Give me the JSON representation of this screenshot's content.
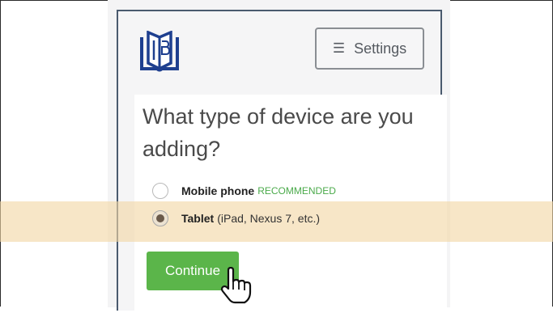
{
  "header": {
    "logo_icon": "book-logo-icon",
    "settings_label": "Settings",
    "settings_icon": "hamburger-menu-icon"
  },
  "question": "What type of device are you adding?",
  "options": [
    {
      "title": "Mobile phone",
      "tag": "RECOMMENDED",
      "note": "",
      "selected": false
    },
    {
      "title": "Tablet",
      "tag": "",
      "note": "(iPad, Nexus 7, etc.)",
      "selected": true
    }
  ],
  "continue_label": "Continue",
  "colors": {
    "brand": "#1e3f8f",
    "primary_button": "#5bb54a",
    "recommended": "#4aaa4a",
    "highlight": "#f2d6a5"
  },
  "cursor_icon": "hand-pointer-icon"
}
